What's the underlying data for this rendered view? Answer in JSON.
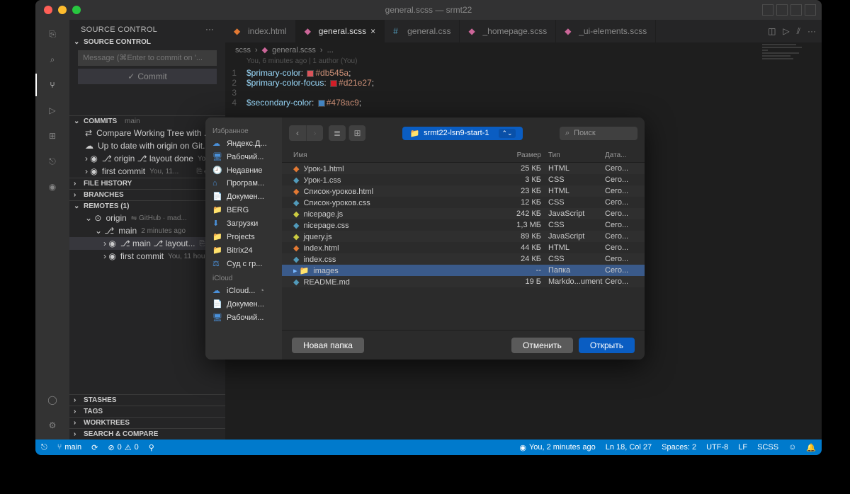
{
  "window_title": "general.scss — srmt22",
  "sidebar": {
    "title": "SOURCE CONTROL",
    "section": "SOURCE CONTROL",
    "commit_placeholder": "Message (⌘Enter to commit on '...",
    "commit_btn": "Commit",
    "commits_head": "COMMITS",
    "commits_branch": "main",
    "compare": "Compare Working Tree with ...",
    "uptodate": "Up to date with origin on Git...",
    "commit1_label": "⎇ origin ⎇  layout done",
    "commit1_meta": "You, ...",
    "commit2_label": "first commit",
    "commit2_meta": "You, 11...",
    "filehistory": "FILE HISTORY",
    "branches": "BRANCHES",
    "remotes": "REMOTES (1)",
    "origin_label": "origin",
    "origin_meta": "⇋ GitHub · mad...",
    "origin_check": "✓",
    "main_label": "main",
    "main_meta": "2 minutes ago",
    "r_commit1": "⎇ main ⎇  layout...",
    "r_commit2": "first commit",
    "r_commit2_meta": "You, 11 hours a...",
    "stashes": "STASHES",
    "tags": "TAGS",
    "worktrees": "WORKTREES",
    "search_compare": "SEARCH & COMPARE"
  },
  "tabs": {
    "t1": "index.html",
    "t2": "general.scss",
    "t3": "general.css",
    "t4": "_homepage.scss",
    "t5": "_ui-elements.scss"
  },
  "breadcrumb": {
    "p1": "scss",
    "p2": "general.scss",
    "p3": "..."
  },
  "blame": "You, 6 minutes ago | 1 author (You)",
  "code": {
    "l1a": "$primary-color",
    "l1b": ": ",
    "l1c": "#db545a",
    "l1d": ";",
    "l2a": "$primary-color-focus",
    "l2b": ": ",
    "l2c": "#d21e27",
    "l2d": ";",
    "l4a": "$secondary-color",
    "l4b": ": ",
    "l4c": "#478ac9",
    "l4d": ";"
  },
  "statusbar": {
    "branch": "main",
    "sync": "",
    "errors": "0",
    "warnings": "0",
    "blame": "You, 2 minutes ago",
    "lncol": "Ln 18, Col 27",
    "spaces": "Spaces: 2",
    "encoding": "UTF-8",
    "eol": "LF",
    "lang": "SCSS"
  },
  "dialog": {
    "favorites": "Избранное",
    "fav_items": [
      "Яндекс.Д...",
      "Рабочий...",
      "Недавние",
      "Програм...",
      "Докумен...",
      "BERG",
      "Загрузки",
      "Projects",
      "Bitrix24",
      "Суд с гр..."
    ],
    "icloud_head": "iCloud",
    "icloud_items": [
      "iCloud...",
      "Докумен...",
      "Рабочий..."
    ],
    "path": "srmt22-lsn9-start-1",
    "search_placeholder": "Поиск",
    "cols": {
      "name": "Имя",
      "size": "Размер",
      "type": "Тип",
      "date": "Дата..."
    },
    "rows": [
      {
        "name": "Урок-1.html",
        "size": "25 КБ",
        "type": "HTML",
        "date": "Сего...",
        "f": "html"
      },
      {
        "name": "Урок-1.css",
        "size": "3 КБ",
        "type": "CSS",
        "date": "Сего...",
        "f": "css"
      },
      {
        "name": "Список-уроков.html",
        "size": "23 КБ",
        "type": "HTML",
        "date": "Сего...",
        "f": "html"
      },
      {
        "name": "Список-уроков.css",
        "size": "12 КБ",
        "type": "CSS",
        "date": "Сего...",
        "f": "css"
      },
      {
        "name": "nicepage.js",
        "size": "242 КБ",
        "type": "JavaScript",
        "date": "Сего...",
        "f": "js"
      },
      {
        "name": "nicepage.css",
        "size": "1,3 МБ",
        "type": "CSS",
        "date": "Сего...",
        "f": "css"
      },
      {
        "name": "jquery.js",
        "size": "89 КБ",
        "type": "JavaScript",
        "date": "Сего...",
        "f": "js"
      },
      {
        "name": "index.html",
        "size": "44 КБ",
        "type": "HTML",
        "date": "Сего...",
        "f": "html"
      },
      {
        "name": "index.css",
        "size": "24 КБ",
        "type": "CSS",
        "date": "Сего...",
        "f": "css"
      },
      {
        "name": "images",
        "size": "--",
        "type": "Папка",
        "date": "Сего...",
        "f": "folder",
        "sel": true
      },
      {
        "name": "README.md",
        "size": "19 Б",
        "type": "Markdo...ument",
        "date": "Сего...",
        "f": "md"
      }
    ],
    "new_folder": "Новая папка",
    "cancel": "Отменить",
    "open": "Открыть"
  }
}
